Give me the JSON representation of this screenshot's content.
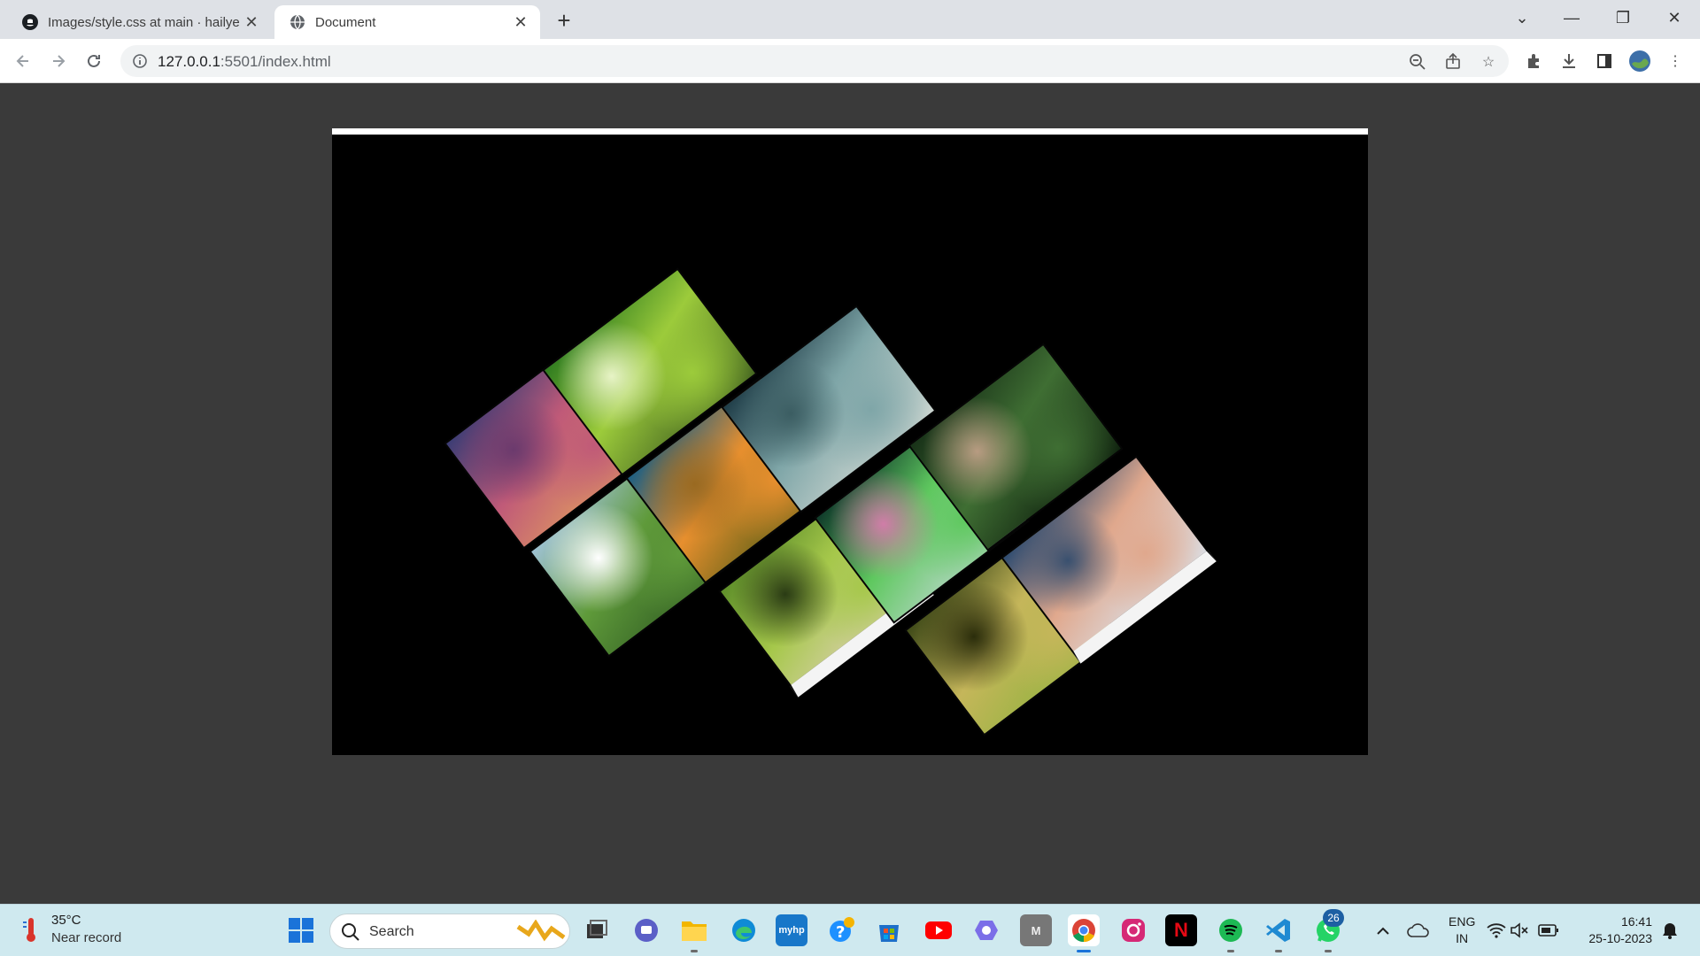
{
  "browser": {
    "tabs": [
      {
        "title": "Images/style.css at main · hailye",
        "active": false,
        "icon": "github-icon"
      },
      {
        "title": "Document",
        "active": true,
        "icon": "globe-icon"
      }
    ],
    "url_host": "127.0.0.1",
    "url_path": ":5501/index.html"
  },
  "gallery": {
    "photos": [
      {
        "name": "sunset-meadow-flowers",
        "colors": [
          "#3b3d75",
          "#c05a78",
          "#e3a25d",
          "#6b3a6d"
        ]
      },
      {
        "name": "forest-stream-moss",
        "colors": [
          "#2f7c20",
          "#9ccb3b",
          "#3f5e1f",
          "#e7f3c6"
        ]
      },
      {
        "name": "green-valley-river",
        "colors": [
          "#9fc2d4",
          "#5f9a3a",
          "#2f5b22",
          "#ffffff"
        ]
      },
      {
        "name": "lone-tree-sunset-field",
        "colors": [
          "#1d5f83",
          "#e78f2e",
          "#4e5b14",
          "#9a6a21"
        ]
      },
      {
        "name": "misty-mountain-lake",
        "colors": [
          "#1e3c47",
          "#7fa6a8",
          "#d3dad4",
          "#3b5d62"
        ]
      },
      {
        "name": "bokeh-leaves-stones",
        "colors": [
          "#5f8f2a",
          "#a6c84b",
          "#ded0b6",
          "#2a3b14"
        ]
      },
      {
        "name": "waterfall-lotus",
        "colors": [
          "#0f3a2a",
          "#5fc85f",
          "#c7d9d9",
          "#d07da8"
        ]
      },
      {
        "name": "hand-touching-fern",
        "colors": [
          "#183118",
          "#3f6e33",
          "#0c1c0c",
          "#b89c82"
        ]
      },
      {
        "name": "glass-globe-moss",
        "colors": [
          "#3f4a18",
          "#c5b65a",
          "#8fb33e",
          "#2b2d0b"
        ]
      },
      {
        "name": "seagulls-ocean-sunset",
        "colors": [
          "#2d4b70",
          "#e0a88d",
          "#dbe2ea",
          "#39506f"
        ]
      }
    ]
  },
  "taskbar": {
    "weather_temp": "35°C",
    "weather_desc": "Near record",
    "search_placeholder": "Search",
    "whatsapp_badge": "26",
    "lang_top": "ENG",
    "lang_bottom": "IN",
    "time": "16:41",
    "date": "25-10-2023"
  }
}
